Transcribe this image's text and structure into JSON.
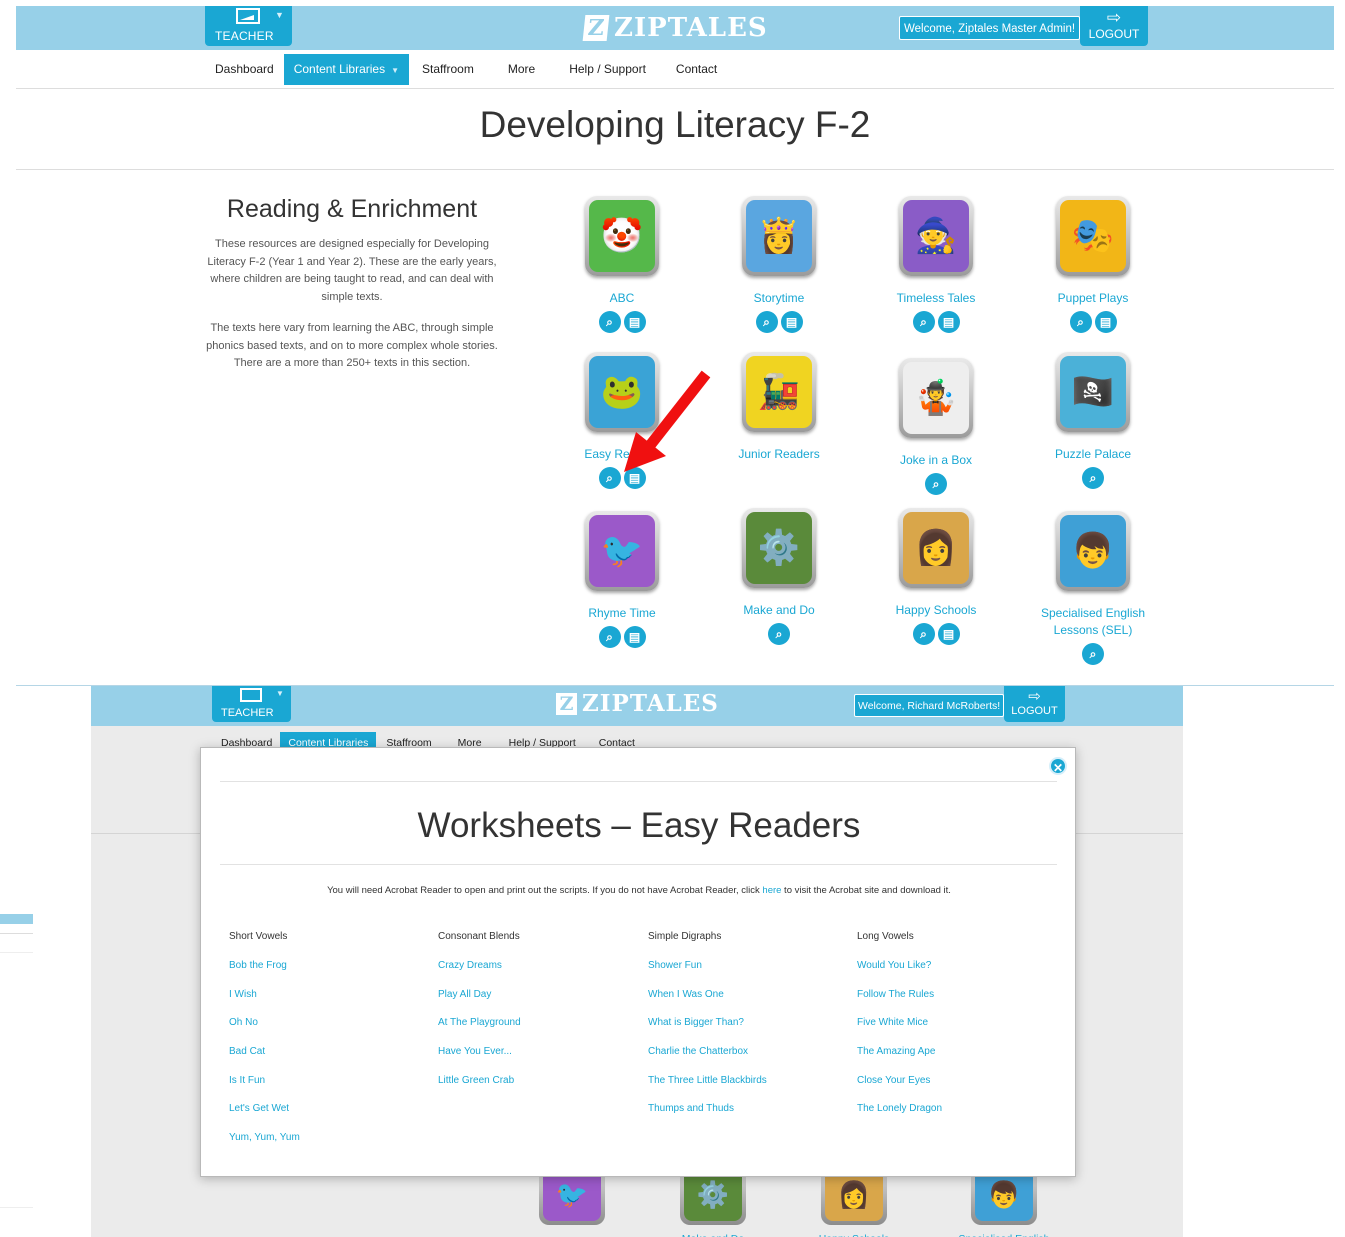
{
  "top": {
    "header": {
      "role_label": "TEACHER",
      "brand": "ZIPTALES",
      "brand_mark": "Z",
      "welcome": "Welcome, Ziptales Master Admin!",
      "logout_label": "LOGOUT",
      "logout_icon": "sign-out-icon"
    },
    "nav": [
      "Dashboard",
      "Content Libraries",
      "Staffroom",
      "More",
      "Help / Support",
      "Contact"
    ],
    "page_title": "Developing Literacy F-2",
    "intro": {
      "heading": "Reading & Enrichment",
      "p1": "These resources are designed especially for Developing Literacy F-2 (Year 1 and Year 2). These are the early years, where children are being taught to read, and can deal with simple texts.",
      "p2": "The texts here vary from learning the ABC, through simple phonics based texts, and on to more complex whole stories. There are a more than 250+ texts in this section."
    },
    "tiles": [
      {
        "name": "ABC",
        "icon": "🤡",
        "bg": "#55b84a",
        "search": true,
        "worksheet": true
      },
      {
        "name": "Storytime",
        "icon": "👸",
        "bg": "#5aa6e0",
        "search": true,
        "worksheet": true
      },
      {
        "name": "Timeless Tales",
        "icon": "🧙",
        "bg": "#8a5cc7",
        "search": true,
        "worksheet": true
      },
      {
        "name": "Puppet Plays",
        "icon": "🎭",
        "bg": "#f2b617",
        "search": true,
        "worksheet": true
      },
      {
        "name": "Easy Readers",
        "icon": "🐸",
        "bg": "#3aa3d6",
        "search": true,
        "worksheet": true
      },
      {
        "name": "Junior Readers",
        "icon": "🚂",
        "bg": "#f0d421",
        "search": false,
        "worksheet": false
      },
      {
        "name": "Joke in a Box",
        "icon": "🤹",
        "bg": "#eeeeee",
        "search": true,
        "worksheet": false
      },
      {
        "name": "Puzzle Palace",
        "icon": "🏴‍☠️",
        "bg": "#4bb1d8",
        "search": true,
        "worksheet": false
      },
      {
        "name": "Rhyme Time",
        "icon": "🐦",
        "bg": "#9b59c9",
        "search": true,
        "worksheet": true
      },
      {
        "name": "Make and Do",
        "icon": "⚙️",
        "bg": "#5a8a3a",
        "search": true,
        "worksheet": false
      },
      {
        "name": "Happy Schools",
        "icon": "👩",
        "bg": "#d9a64a",
        "search": true,
        "worksheet": true
      },
      {
        "name": "Specialised English Lessons (SEL)",
        "icon": "👦",
        "bg": "#3fa0d6",
        "search": true,
        "worksheet": false
      }
    ],
    "search_icon": "search-icon",
    "worksheet_icon": "document-icon",
    "annotation_color": "#f01010"
  },
  "bottom": {
    "header": {
      "role_label": "TEACHER",
      "brand": "ZIPTALES",
      "brand_mark": "Z",
      "welcome": "Welcome, Richard McRoberts!",
      "logout_label": "LOGOUT"
    },
    "nav": [
      "Dashboard",
      "Content Libraries",
      "Staffroom",
      "More",
      "Help / Support",
      "Contact"
    ],
    "background_tiles": [
      {
        "name": "Rhyme Time",
        "icon": "🐦",
        "bg": "#9b59c9"
      },
      {
        "name": "Make and Do",
        "icon": "⚙️",
        "bg": "#5a8a3a"
      },
      {
        "name": "Happy Schools",
        "icon": "👩",
        "bg": "#d9a64a"
      },
      {
        "name": "Specialised English",
        "icon": "👦",
        "bg": "#3fa0d6"
      }
    ],
    "modal": {
      "title": "Worksheets – Easy Readers",
      "note_before": "You will need Acrobat Reader to open and print out the scripts. If you do not have Acrobat Reader, click ",
      "note_link": "here",
      "note_after": " to visit the Acrobat site and download it.",
      "close_icon": "close-icon",
      "columns": [
        {
          "heading": "Short Vowels",
          "links": [
            "Bob the Frog",
            "I Wish",
            "Oh No",
            "Bad Cat",
            "Is It Fun",
            "Let's Get Wet",
            "Yum, Yum, Yum"
          ]
        },
        {
          "heading": "Consonant Blends",
          "links": [
            "Crazy Dreams",
            "Play All Day",
            "At The Playground",
            "Have You Ever...",
            "Little Green Crab"
          ]
        },
        {
          "heading": "Simple Digraphs",
          "links": [
            "Shower Fun",
            "When I Was One",
            "What is Bigger Than?",
            "Charlie the Chatterbox",
            "The Three Little Blackbirds",
            "Thumps and Thuds"
          ]
        },
        {
          "heading": "Long Vowels",
          "links": [
            "Would You Like?",
            "Follow The Rules",
            "Five White Mice",
            "The Amazing Ape",
            "Close Your Eyes",
            "The Lonely Dragon"
          ]
        }
      ]
    }
  }
}
